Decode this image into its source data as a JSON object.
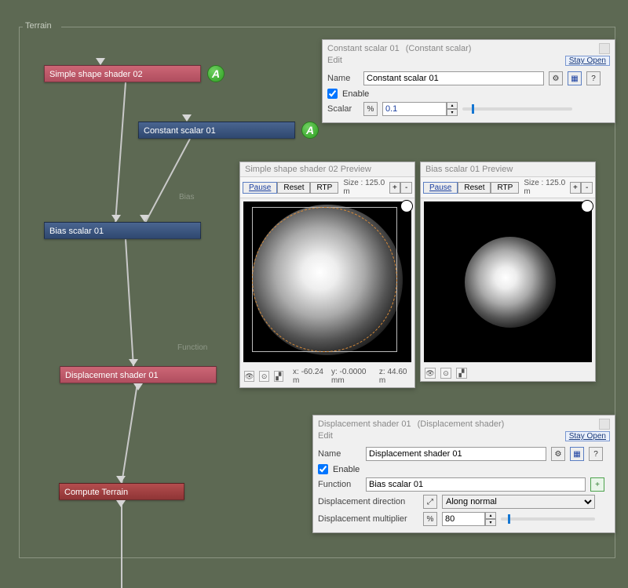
{
  "panel": {
    "title": "Terrain"
  },
  "nodes": {
    "shape": "Simple shape shader 02",
    "constant": "Constant scalar 01",
    "bias": "Bias scalar 01",
    "displacement": "Displacement shader 01",
    "compute": "Compute Terrain",
    "label_bias": "Bias",
    "label_function": "Function"
  },
  "a_badge": "A",
  "panel_const": {
    "title_a": "Constant scalar 01",
    "title_b": "(Constant scalar)",
    "edit": "Edit",
    "stay_open": "Stay Open",
    "name_lbl": "Name",
    "name_val": "Constant scalar 01",
    "enable_lbl": "Enable",
    "scalar_lbl": "Scalar",
    "scalar_val": "0.1",
    "percent_btn": "%"
  },
  "preview_a": {
    "title": "Simple shape shader 02 Preview",
    "pause": "Pause",
    "reset": "Reset",
    "rtp": "RTP",
    "size": "Size : 125.0 m",
    "plus": "+",
    "minus": "-",
    "x": "x: -60.24 m",
    "y": "y: -0.0000 mm",
    "z": "z: 44.60 m"
  },
  "preview_b": {
    "title": "Bias scalar 01 Preview",
    "pause": "Pause",
    "reset": "Reset",
    "rtp": "RTP",
    "size": "Size : 125.0 m",
    "plus": "+",
    "minus": "-"
  },
  "panel_disp": {
    "title_a": "Displacement shader 01",
    "title_b": "(Displacement shader)",
    "edit": "Edit",
    "stay_open": "Stay Open",
    "name_lbl": "Name",
    "name_val": "Displacement shader 01",
    "enable_lbl": "Enable",
    "function_lbl": "Function",
    "function_val": "Bias scalar 01",
    "dir_lbl": "Displacement direction",
    "dir_val": "Along normal",
    "mult_lbl": "Displacement multiplier",
    "mult_val": "80",
    "percent_btn": "%"
  },
  "icons": {
    "gear": "⚙",
    "help": "?",
    "eye": "👁",
    "plus": "+"
  },
  "chart_data": null
}
